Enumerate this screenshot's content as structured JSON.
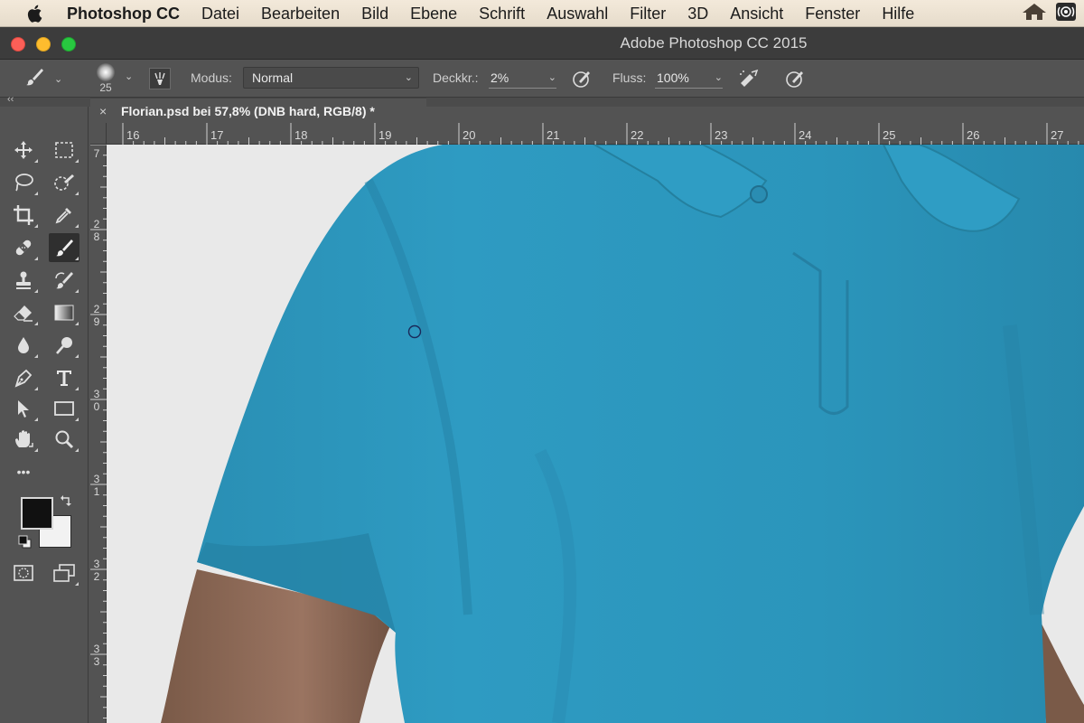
{
  "menubar": {
    "app_name": "Photoshop CC",
    "items": [
      "Datei",
      "Bearbeiten",
      "Bild",
      "Ebene",
      "Schrift",
      "Auswahl",
      "Filter",
      "3D",
      "Ansicht",
      "Fenster",
      "Hilfe"
    ]
  },
  "window": {
    "title": "Adobe Photoshop CC 2015"
  },
  "options": {
    "brush_size": "25",
    "mode_label": "Modus:",
    "mode_value": "Normal",
    "opacity_label": "Deckkr.:",
    "opacity_value": "2%",
    "flow_label": "Fluss:",
    "flow_value": "100%"
  },
  "document": {
    "tab_title": "Florian.psd bei 57,8% (DNB hard, RGB/8) *",
    "close_glyph": "×"
  },
  "rulers": {
    "top": [
      "16",
      "17",
      "18",
      "19",
      "20",
      "21",
      "22",
      "23",
      "24",
      "25",
      "26",
      "27"
    ],
    "left": [
      {
        "d1": "7",
        "d2": ""
      },
      {
        "d1": "2",
        "d2": "8"
      },
      {
        "d1": "2",
        "d2": "9"
      },
      {
        "d1": "3",
        "d2": "0"
      },
      {
        "d1": "3",
        "d2": "1"
      },
      {
        "d1": "3",
        "d2": "2"
      },
      {
        "d1": "3",
        "d2": "3"
      }
    ]
  },
  "colors": {
    "foreground": "#111111",
    "background": "#f2f2f2",
    "shirt": "#2b97bd"
  },
  "tools": {
    "more_glyph": "•••"
  }
}
